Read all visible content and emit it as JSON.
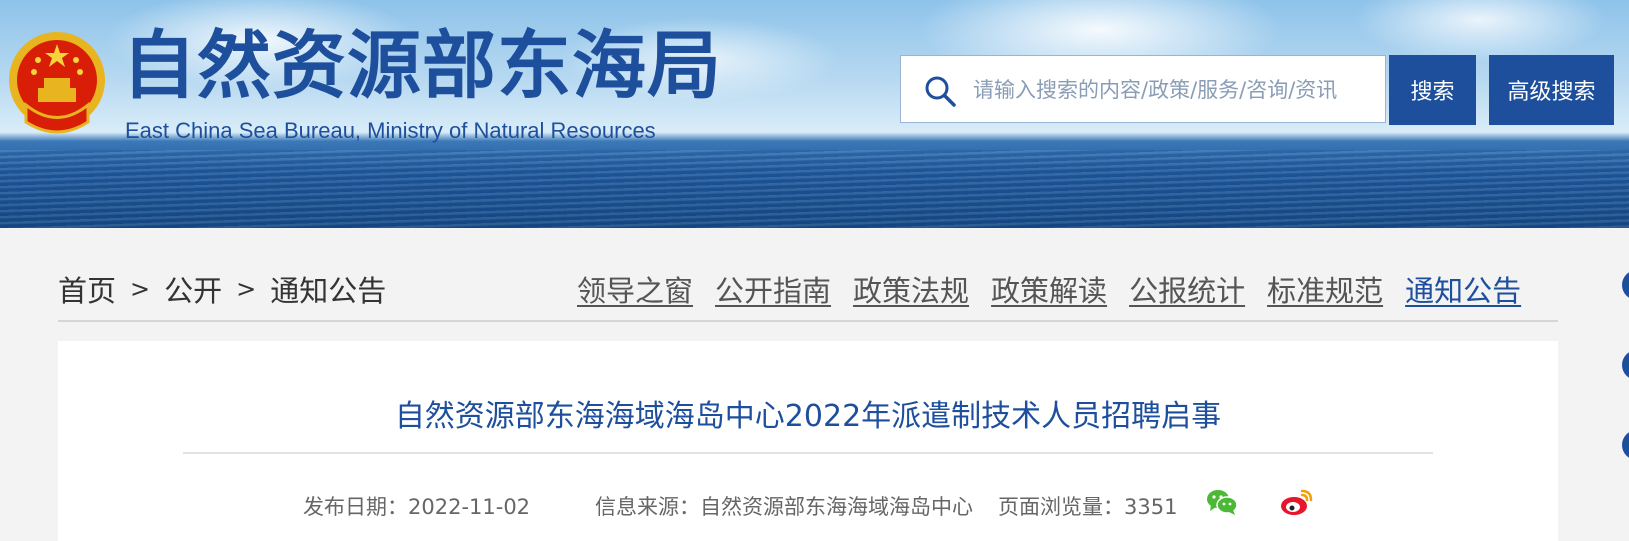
{
  "header": {
    "site_title": "自然资源部东海局",
    "site_subtitle": "East China Sea Bureau, Ministry of Natural Resources",
    "emblem_icon": "national-emblem-icon"
  },
  "search": {
    "placeholder": "请输入搜索的内容/政策/服务/咨询/资讯",
    "search_label": "搜索",
    "advanced_label": "高级搜索"
  },
  "breadcrumb": {
    "items": [
      "首页",
      "公开",
      "通知公告"
    ],
    "separator": ">"
  },
  "category_nav": {
    "items": [
      "领导之窗",
      "公开指南",
      "政策法规",
      "政策解读",
      "公报统计",
      "标准规范",
      "通知公告"
    ],
    "active_index": 6
  },
  "article": {
    "title": "自然资源部东海海域海岛中心2022年派遣制技术人员招聘启事",
    "publish_date": "发布日期：2022-11-02",
    "source": "信息来源：自然资源部东海海域海岛中心",
    "views": "页面浏览量：3351",
    "share_icons": [
      "wechat-icon",
      "weibo-icon"
    ]
  },
  "colors": {
    "brand_blue": "#1e4f9c",
    "button_blue": "#1d4f9c",
    "page_bg": "#f3f3f3",
    "wechat_green": "#4bb936",
    "weibo_red": "#e6162d"
  }
}
